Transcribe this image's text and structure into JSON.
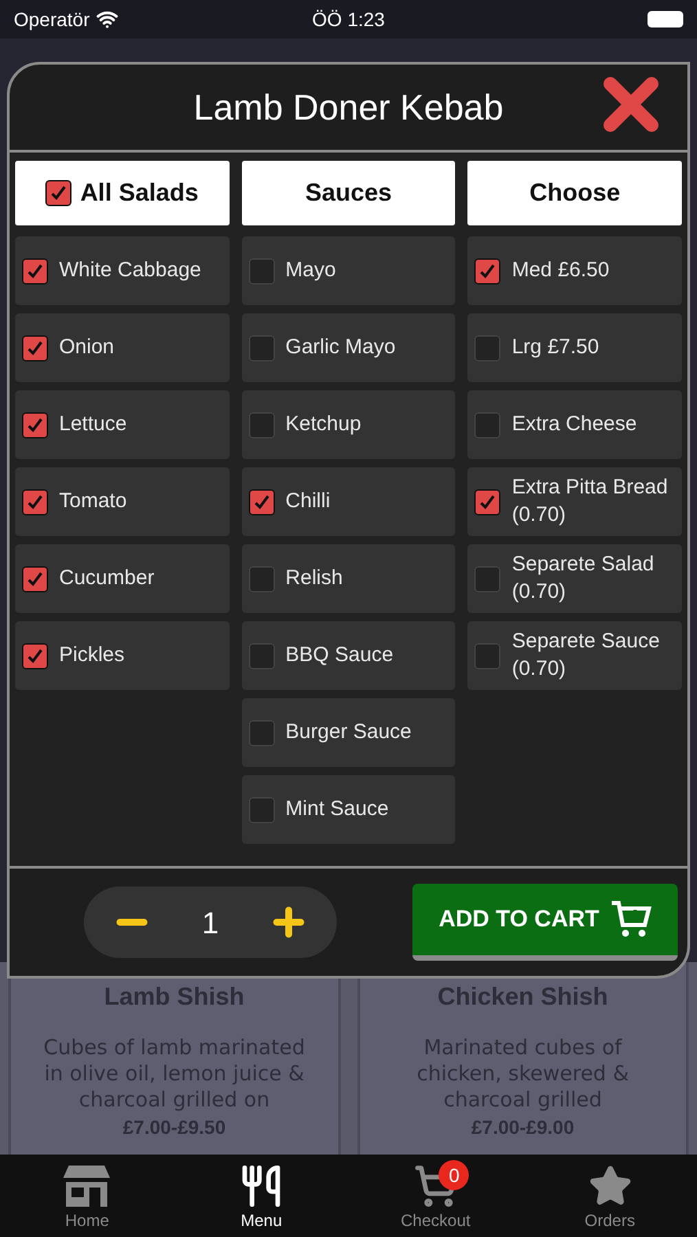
{
  "status_bar": {
    "carrier": "Operatör",
    "time": "ÖÖ 1:23"
  },
  "modal": {
    "title": "Lamb Doner Kebab",
    "columns": [
      {
        "header": "All Salads",
        "kind": "checkbox",
        "checked": true,
        "items": [
          {
            "label": "White Cabbage",
            "checked": true
          },
          {
            "label": "Onion",
            "checked": true
          },
          {
            "label": "Lettuce",
            "checked": true
          },
          {
            "label": "Tomato",
            "checked": true
          },
          {
            "label": "Cucumber",
            "checked": true
          },
          {
            "label": "Pickles",
            "checked": true
          }
        ]
      },
      {
        "header": "Sauces",
        "kind": "plain",
        "items": [
          {
            "label": "Mayo",
            "checked": false
          },
          {
            "label": "Garlic Mayo",
            "checked": false
          },
          {
            "label": "Ketchup",
            "checked": false
          },
          {
            "label": "Chilli",
            "checked": true
          },
          {
            "label": "Relish",
            "checked": false
          },
          {
            "label": "BBQ Sauce",
            "checked": false
          },
          {
            "label": "Burger Sauce",
            "checked": false
          },
          {
            "label": "Mint Sauce",
            "checked": false
          }
        ]
      },
      {
        "header": "Choose",
        "kind": "plain",
        "items": [
          {
            "label": "Med £6.50",
            "checked": true
          },
          {
            "label": "Lrg £7.50",
            "checked": false
          },
          {
            "label": "Extra Cheese",
            "checked": false
          },
          {
            "label": "Extra Pitta Bread (0.70)",
            "checked": true
          },
          {
            "label": "Separete Salad (0.70)",
            "checked": false
          },
          {
            "label": "Separete Sauce (0.70)",
            "checked": false
          }
        ]
      }
    ],
    "quantity": "1",
    "add_button": "ADD TO CART"
  },
  "background_cards": [
    {
      "title": "Lamb Shish",
      "description": "Cubes of lamb marinated in olive oil, lemon juice & charcoal grilled on",
      "price": "£7.00-£9.50"
    },
    {
      "title": "Chicken Shish",
      "description": "Marinated cubes of chicken, skewered & charcoal grilled",
      "price": "£7.00-£9.00"
    }
  ],
  "tab_bar": [
    {
      "kind": "home",
      "label": "Home",
      "selected": false
    },
    {
      "kind": "menu",
      "label": "Menu",
      "selected": true
    },
    {
      "kind": "checkout",
      "label": "Checkout",
      "selected": false,
      "badge": "0"
    },
    {
      "kind": "orders",
      "label": "Orders",
      "selected": false
    }
  ]
}
